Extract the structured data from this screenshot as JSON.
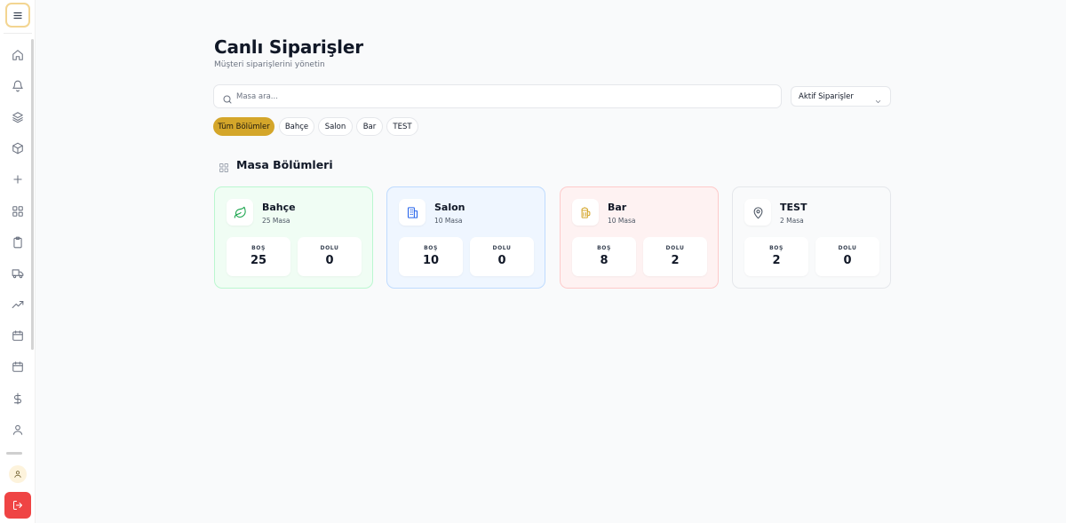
{
  "sidebar": {
    "menu_icon": "hamburger-icon",
    "items": [
      {
        "icon": "home-icon"
      },
      {
        "icon": "bell-icon"
      },
      {
        "icon": "layers-icon"
      },
      {
        "icon": "box-icon"
      },
      {
        "icon": "plus-icon"
      },
      {
        "icon": "grid-icon"
      },
      {
        "icon": "clipboard-icon"
      },
      {
        "icon": "truck-icon"
      },
      {
        "icon": "trending-up-icon"
      },
      {
        "icon": "calendar-icon"
      },
      {
        "icon": "calendar-icon"
      },
      {
        "icon": "dollar-icon"
      },
      {
        "icon": "user-icon"
      }
    ],
    "avatar_icon": "user-icon",
    "logout_icon": "logout-icon",
    "logout_color": "#ef4444"
  },
  "header": {
    "title": "Canlı Siparişler",
    "subtitle": "Müşteri siparişlerini yönetin"
  },
  "search": {
    "placeholder": "Masa ara...",
    "value": ""
  },
  "status_select": {
    "selected": "Aktif Siparişler"
  },
  "filters": [
    {
      "label": "Tüm Bölümler",
      "active": true
    },
    {
      "label": "Bahçe",
      "active": false
    },
    {
      "label": "Salon",
      "active": false
    },
    {
      "label": "Bar",
      "active": false
    },
    {
      "label": "TEST",
      "active": false
    }
  ],
  "accent_color": "#d4a62a",
  "section": {
    "title": "Masa Bölümleri"
  },
  "sections": [
    {
      "name": "Bahçe",
      "count": "25 Masa",
      "empty_label": "BOŞ",
      "empty": "25",
      "full_label": "DOLU",
      "full": "0",
      "icon": "leaf-icon",
      "theme": "#22c55e"
    },
    {
      "name": "Salon",
      "count": "10 Masa",
      "empty_label": "BOŞ",
      "empty": "10",
      "full_label": "DOLU",
      "full": "0",
      "icon": "building-icon",
      "theme": "#3b82f6"
    },
    {
      "name": "Bar",
      "count": "10 Masa",
      "empty_label": "BOŞ",
      "empty": "8",
      "full_label": "DOLU",
      "full": "2",
      "icon": "beer-icon",
      "theme": "#ef4444"
    },
    {
      "name": "TEST",
      "count": "2 Masa",
      "empty_label": "BOŞ",
      "empty": "2",
      "full_label": "DOLU",
      "full": "0",
      "icon": "map-pin-icon",
      "theme": "#9ca3af"
    }
  ]
}
